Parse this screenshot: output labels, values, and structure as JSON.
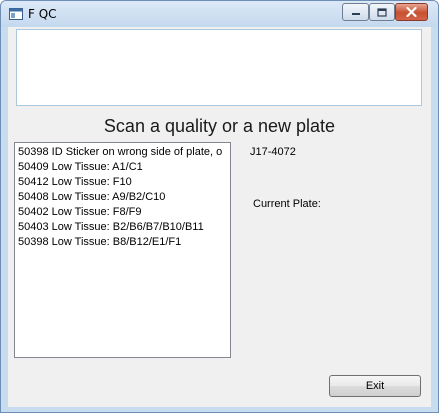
{
  "window": {
    "title": "F QC",
    "colors": {
      "frame": "#c7dcef",
      "close_button": "#c7502f",
      "client": "#f0f0f0"
    }
  },
  "main": {
    "heading": "Scan a quality or a new plate",
    "scan_log": [
      "50398 ID Sticker on wrong side of plate, o",
      "50409 Low Tissue: A1/C1",
      "50412 Low Tissue: F10",
      "50408 Low Tissue: A9/B2/C10",
      "50402 Low Tissue: F8/F9",
      "50403 Low Tissue: B2/B6/B7/B10/B11",
      "50398 Low Tissue: B8/B12/E1/F1"
    ],
    "plate_id": "J17-4072",
    "current_plate_label": "Current Plate:",
    "exit_label": "Exit"
  },
  "icons": {
    "app": "window-app-icon",
    "minimize": "minimize-icon",
    "maximize": "maximize-icon",
    "close": "close-icon"
  }
}
